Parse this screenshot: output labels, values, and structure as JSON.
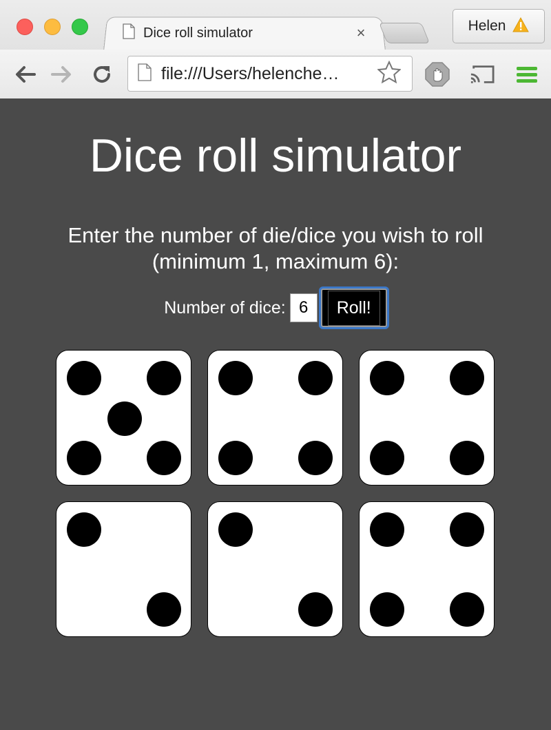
{
  "browser": {
    "tab_title": "Dice roll simulator",
    "tab_close": "×",
    "profile_name": "Helen",
    "address": "file:///Users/helenche…"
  },
  "page": {
    "title": "Dice roll simulator",
    "instructions_line1": "Enter the number of die/dice you wish to roll",
    "instructions_line2": "(minimum 1, maximum 6):",
    "input_label": "Number of dice:",
    "input_value": "6",
    "roll_label": "Roll!"
  },
  "dice": [
    5,
    4,
    4,
    2,
    2,
    4
  ],
  "colors": {
    "background": "#4a4a4a",
    "die": "#ffffff",
    "pip": "#000000",
    "focus_ring": "#3b78c9"
  }
}
